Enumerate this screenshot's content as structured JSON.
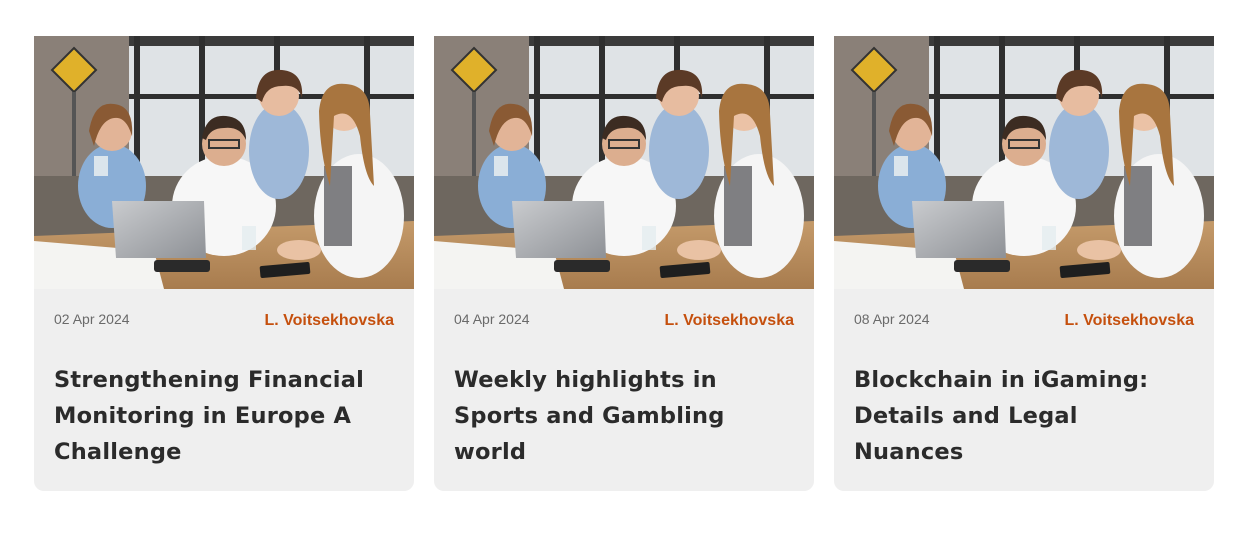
{
  "articles": [
    {
      "date": "02 Apr 2024",
      "author": "L. Voitsekhovska",
      "title": "Strengthening Financial Monitoring in Europe A Challenge"
    },
    {
      "date": "04 Apr 2024",
      "author": "L. Voitsekhovska",
      "title": "Weekly highlights in Sports and Gambling world"
    },
    {
      "date": "08 Apr 2024",
      "author": "L. Voitsekhovska",
      "title": "Blockchain in iGaming: Details and Legal Nuances"
    }
  ],
  "colors": {
    "card_bg": "#efefef",
    "author_accent": "#c5500e",
    "title_text": "#2b2b2b",
    "date_text": "#6a6a6a"
  }
}
